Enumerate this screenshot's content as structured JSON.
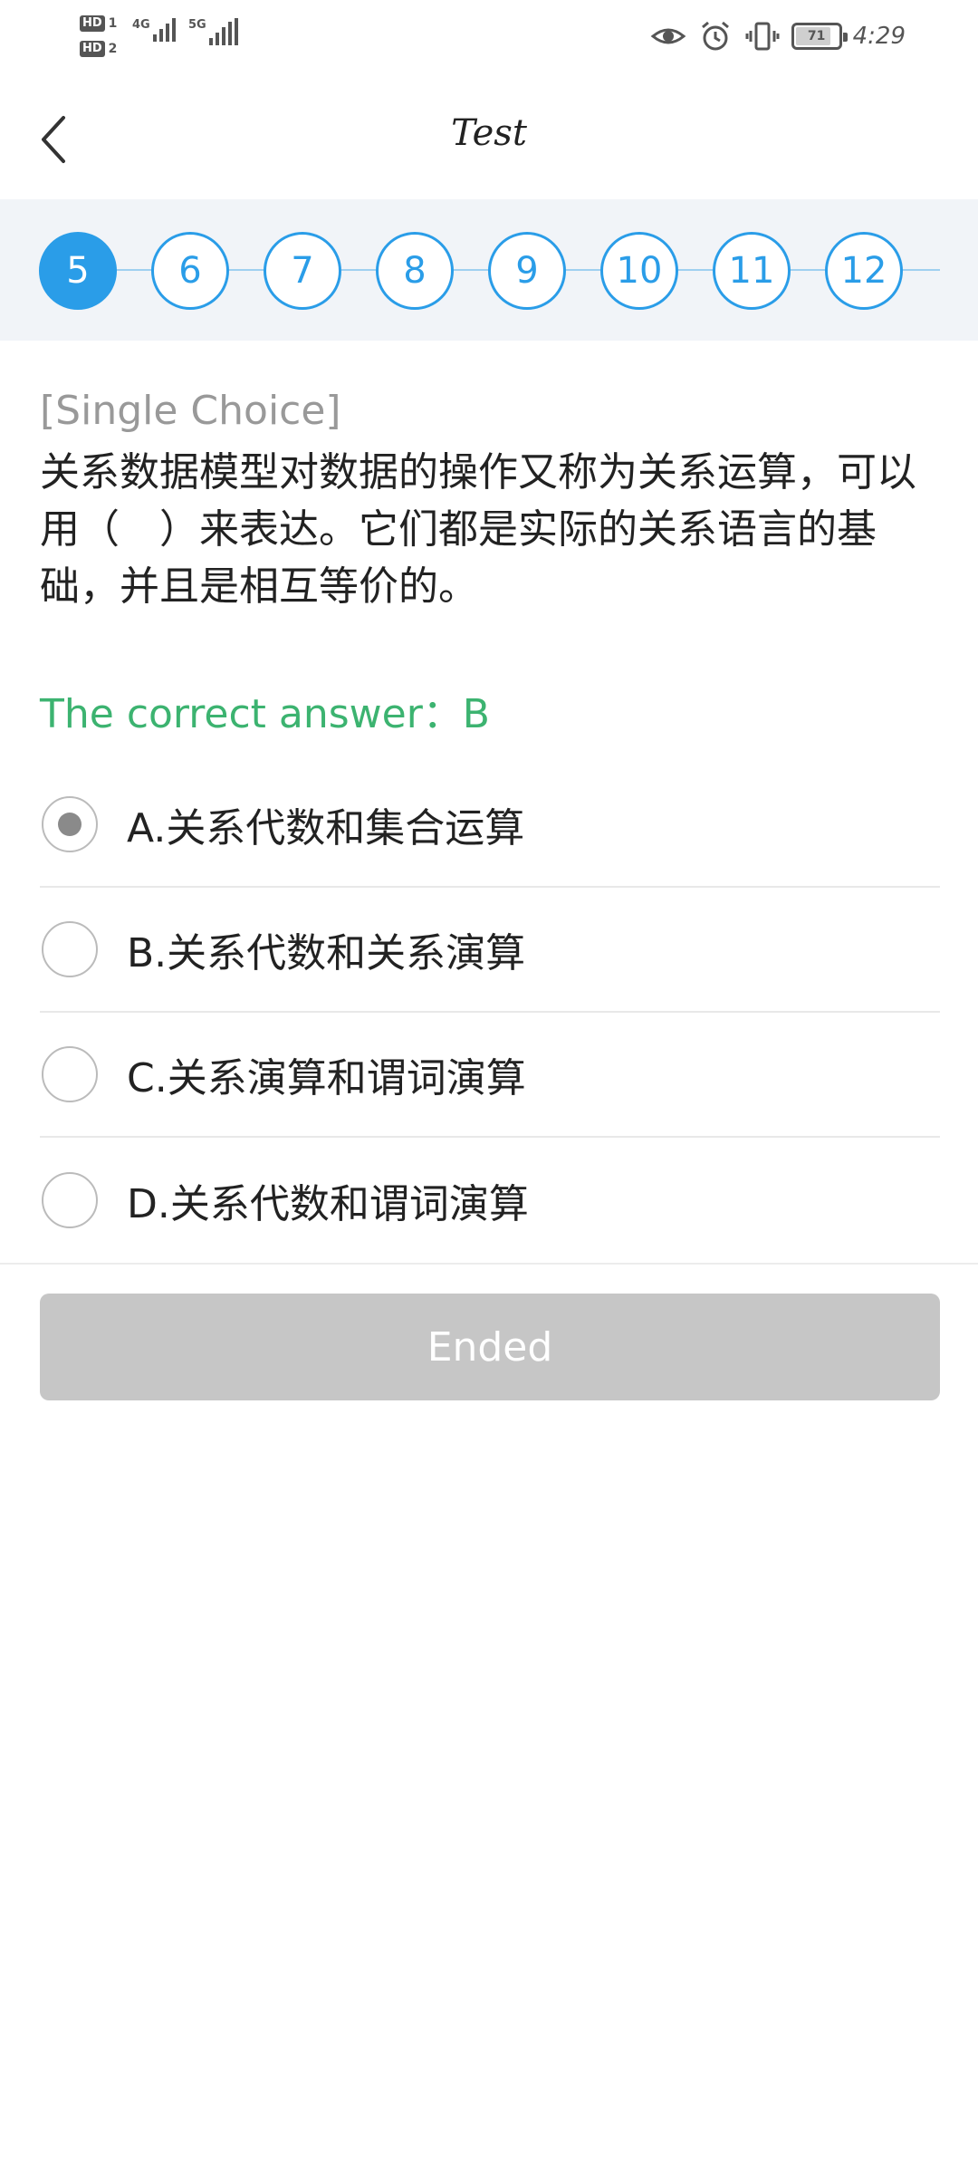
{
  "status_bar": {
    "sim1_badge": "HD",
    "sim1_num": "1",
    "sim2_badge": "HD",
    "sim2_num": "2",
    "network1": "4G",
    "network2": "5G",
    "battery_level": "71",
    "time": "4:29"
  },
  "header": {
    "title": "Test"
  },
  "question_nav": {
    "items": [
      "5",
      "6",
      "7",
      "8",
      "9",
      "10",
      "11",
      "12"
    ],
    "active": "5"
  },
  "question": {
    "type_label": "[Single Choice]",
    "text": "关系数据模型对数据的操作又称为关系运算，可以用（　）来表达。它们都是实际的关系语言的基础，并且是相互等价的。",
    "correct_answer_label": "The correct answer：B",
    "options": [
      {
        "label": "A.关系代数和集合运算",
        "selected": true
      },
      {
        "label": "B.关系代数和关系演算",
        "selected": false
      },
      {
        "label": "C.关系演算和谓词演算",
        "selected": false
      },
      {
        "label": "D.关系代数和谓词演算",
        "selected": false
      }
    ]
  },
  "actions": {
    "ended_label": "Ended"
  },
  "colors": {
    "accent": "#2a9de8",
    "correct": "#3cb370",
    "disabled_button": "#c6c6c6"
  }
}
